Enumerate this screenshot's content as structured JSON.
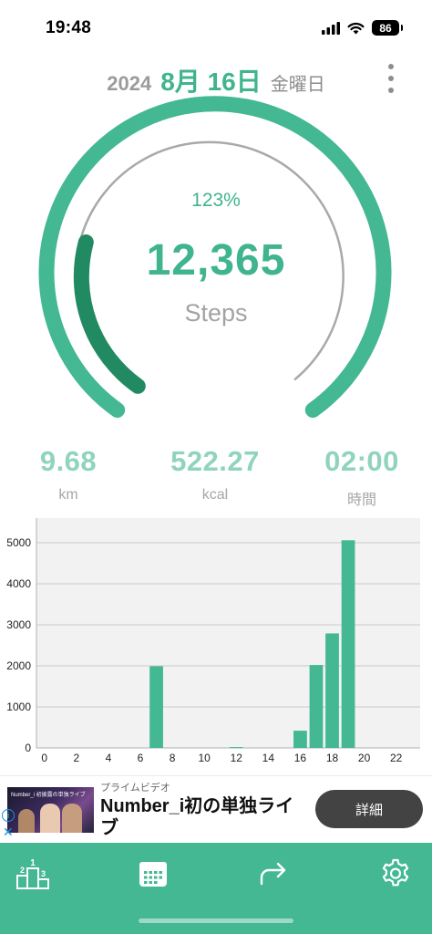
{
  "status_bar": {
    "time": "19:48",
    "battery": "86",
    "icons": [
      "signal-icon",
      "wifi-icon",
      "battery-icon"
    ]
  },
  "header": {
    "year": "2024",
    "date": "8月 16日",
    "weekday": "金曜日"
  },
  "gauge": {
    "percent": "123%",
    "steps": "12,365",
    "unit": "Steps",
    "progress": 1.23
  },
  "stats": [
    {
      "value": "9.68",
      "unit": "km"
    },
    {
      "value": "522.27",
      "unit": "kcal"
    },
    {
      "value": "02:00",
      "unit": "時間"
    }
  ],
  "chart_data": {
    "type": "bar",
    "x": [
      0,
      1,
      2,
      3,
      4,
      5,
      6,
      7,
      8,
      9,
      10,
      11,
      12,
      13,
      14,
      15,
      16,
      17,
      18,
      19,
      20,
      21,
      22,
      23
    ],
    "values": [
      0,
      0,
      0,
      0,
      0,
      0,
      0,
      1990,
      0,
      0,
      0,
      0,
      20,
      0,
      0,
      0,
      420,
      2020,
      2790,
      5060,
      0,
      0,
      0,
      0
    ],
    "x_ticks": [
      "0",
      "2",
      "4",
      "6",
      "8",
      "10",
      "12",
      "14",
      "16",
      "18",
      "20",
      "22"
    ],
    "y_ticks": [
      "0",
      "1000",
      "2000",
      "3000",
      "4000",
      "5000"
    ],
    "ylim": [
      0,
      5600
    ],
    "xlim": [
      -0.5,
      23.5
    ],
    "grid": true,
    "bar_color": "#43b892",
    "background": "#f2f2f2"
  },
  "ad": {
    "sponsor": "プライムビデオ",
    "title": "Number_i初の単独ライブ",
    "button_label": "詳細",
    "thumbnail_text": "Number_i 初披露の単独ライブ"
  },
  "tab_bar": {
    "tabs": [
      "ranking-icon",
      "calendar-icon",
      "share-icon",
      "settings-icon"
    ]
  },
  "colors": {
    "accent": "#3fb48e",
    "accent_dark": "#228a63",
    "tab_bar": "#43b892"
  }
}
